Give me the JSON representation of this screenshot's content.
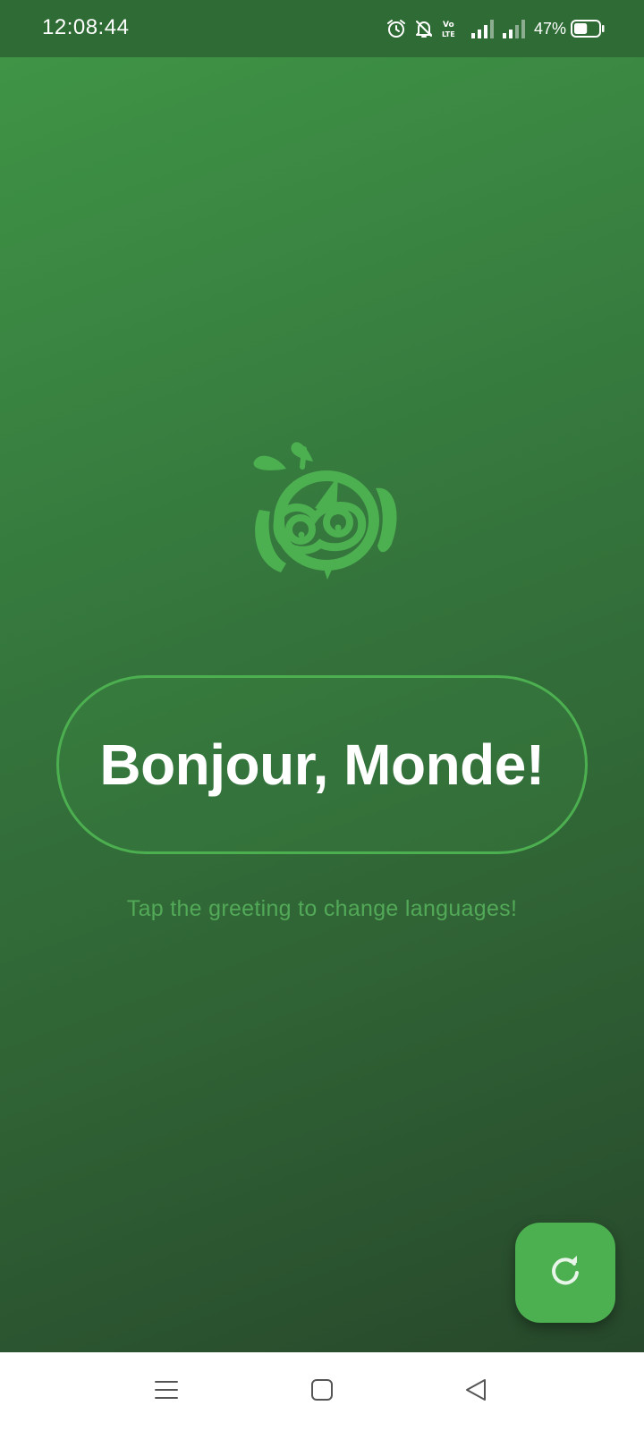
{
  "status_bar": {
    "time": "12:08:44",
    "battery_percent": "47%",
    "battery_level": 0.47,
    "icons": [
      "alarm-icon",
      "bell-off-icon",
      "volte-icon",
      "signal-icon",
      "signal-icon",
      "battery-icon"
    ]
  },
  "main": {
    "greeting": "Bonjour, Monde!",
    "hint": "Tap the greeting to change languages!",
    "logo_icon": "cartoon-bird-logo-icon",
    "fab_icon": "refresh-icon"
  },
  "nav_bar": {
    "icons": [
      "menu-icon",
      "home-square-icon",
      "back-triangle-icon"
    ]
  },
  "colors": {
    "accent": "#4caf50",
    "status_bar_bg": "#2f6b35",
    "hint_text": "#52a957",
    "gradient_top": "#3f9446",
    "gradient_bottom": "#27482b"
  }
}
